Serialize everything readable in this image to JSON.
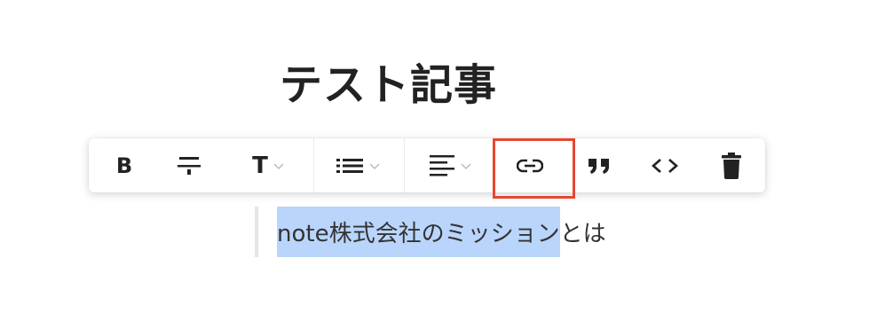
{
  "article": {
    "title": "テスト記事",
    "body_selected": "note株式会社のミッション",
    "body_rest": "とは"
  },
  "toolbar": {
    "buttons": [
      {
        "name": "bold",
        "label": "B",
        "icon": "bold-icon"
      },
      {
        "name": "strikethrough",
        "icon": "strikethrough-icon"
      },
      {
        "name": "heading",
        "label": "T",
        "icon": "heading-icon",
        "has_dropdown": true
      },
      {
        "name": "list",
        "icon": "list-icon",
        "has_dropdown": true
      },
      {
        "name": "align",
        "icon": "align-left-icon",
        "has_dropdown": true
      },
      {
        "name": "link",
        "icon": "link-icon",
        "highlighted": true
      },
      {
        "name": "quote",
        "icon": "quote-icon"
      },
      {
        "name": "code",
        "icon": "code-icon"
      },
      {
        "name": "delete",
        "icon": "trash-icon"
      }
    ]
  },
  "colors": {
    "highlight_border": "#e8472f",
    "selection": "#b9d5fb",
    "text": "#222222"
  }
}
